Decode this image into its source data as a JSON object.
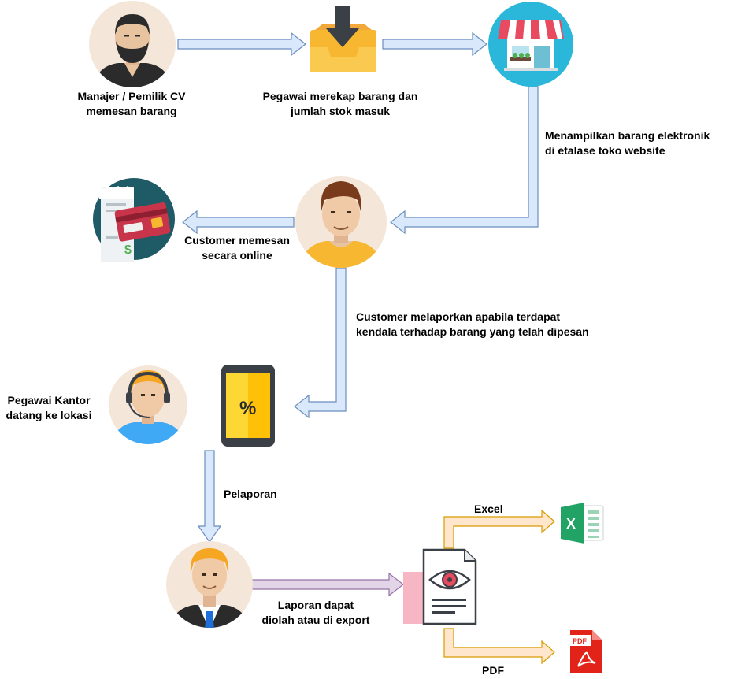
{
  "labels": {
    "manager_order": "Manajer / Pemilik CV\nmemesan barang",
    "staff_record": "Pegawai merekap barang dan\njumlah stok masuk",
    "show_items": "Menampilkan barang elektronik\ndi etalase toko website",
    "customer_order": "Customer memesan\nsecara online",
    "customer_report": "Customer melaporkan apabila terdapat\nkendala terhadap barang yang telah dipesan",
    "office_staff": "Pegawai Kantor\ndatang ke lokasi",
    "reporting": "Pelaporan",
    "report_export": "Laporan dapat\ndiolah atau di export",
    "excel": "Excel",
    "pdf": "PDF",
    "pdf_icon_text": "PDF"
  },
  "colors": {
    "arrow_blue_fill": "#dae8fc",
    "arrow_blue_stroke": "#6c8ebf",
    "arrow_purple_fill": "#e1d5e7",
    "arrow_purple_stroke": "#9673a6",
    "arrow_orange_fill": "#ffe6cc",
    "arrow_orange_stroke": "#d79b00",
    "avatar_bg": "#f4e6d8",
    "store_bg": "#2bb7da",
    "payment_bg": "#1f5b66",
    "excel_green": "#21a366",
    "pdf_red": "#e2231a"
  }
}
